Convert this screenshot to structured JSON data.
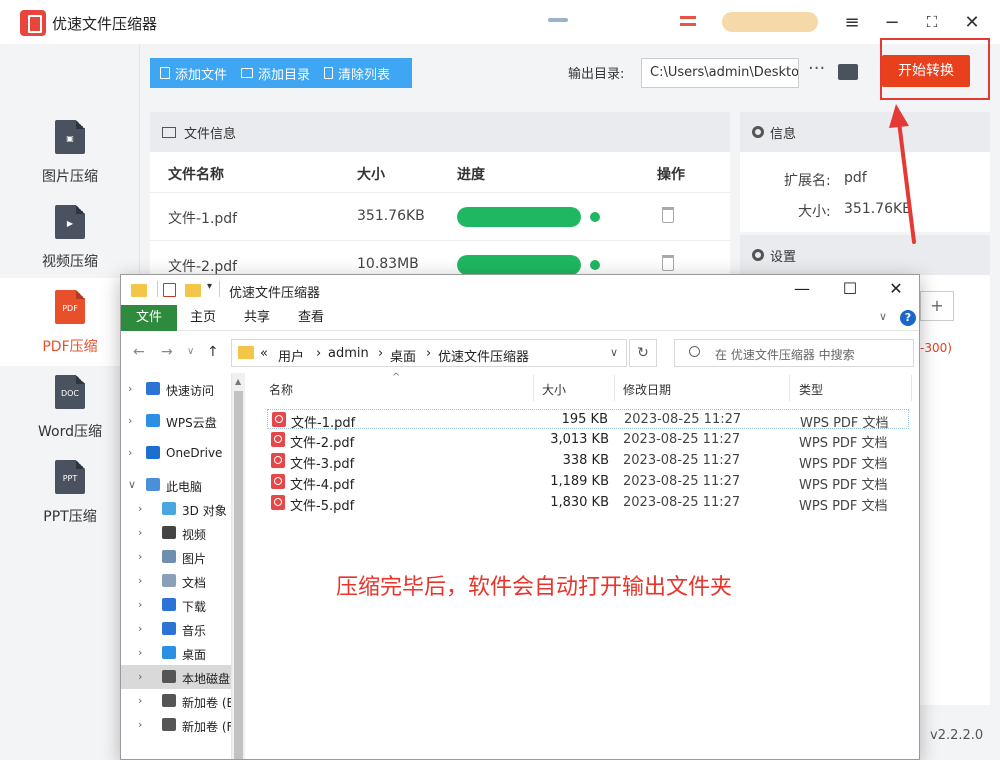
{
  "app": {
    "title": "优速文件压缩器",
    "sidebar": [
      {
        "label": "图片压缩",
        "doc": "",
        "active": false
      },
      {
        "label": "视频压缩",
        "doc": "",
        "active": false
      },
      {
        "label": "PDF压缩",
        "doc": "PDF",
        "active": true
      },
      {
        "label": "Word压缩",
        "doc": "DOC",
        "active": false
      },
      {
        "label": "PPT压缩",
        "doc": "PPT",
        "active": false
      }
    ],
    "toolbar": {
      "add_file": "添加文件",
      "add_dir": "添加目录",
      "clear_list": "清除列表",
      "output_label": "输出目录:",
      "output_value": "C:\\Users\\admin\\Deskto",
      "more": "···",
      "start": "开始转换"
    },
    "file_panel": {
      "title": "文件信息",
      "columns": [
        "文件名称",
        "大小",
        "进度",
        "操作"
      ],
      "rows": [
        {
          "name": "文件-1.pdf",
          "size": "351.76KB",
          "progress": 100
        },
        {
          "name": "文件-2.pdf",
          "size": "10.83MB",
          "progress": 100
        }
      ]
    },
    "info_panel": {
      "title": "信息",
      "ext_label": "扩展名:",
      "ext_value": "pdf",
      "size_label": "大小:",
      "size_value": "351.76KB"
    },
    "settings_panel": {
      "title": "设置",
      "plus": "+",
      "range": "-300)"
    },
    "version": "v2.2.2.0"
  },
  "explorer": {
    "title": "优速文件压缩器",
    "ribbon_tabs": [
      "文件",
      "主页",
      "共享",
      "查看"
    ],
    "help": "?",
    "breadcrumb": [
      "«",
      "用户",
      "›",
      "admin",
      "›",
      "桌面",
      "›",
      "优速文件压缩器"
    ],
    "refresh": "↻",
    "search_placeholder": "在 优速文件压缩器 中搜索",
    "nav": [
      {
        "label": "快速访问",
        "icon": "star-icon",
        "color": "#2b74d6",
        "indent": 0
      },
      {
        "label": "WPS云盘",
        "icon": "cloud-icon",
        "color": "#2b8fe3",
        "indent": 0
      },
      {
        "label": "OneDrive",
        "icon": "onedrive-icon",
        "color": "#1a6fcf",
        "indent": 0
      },
      {
        "label": "此电脑",
        "icon": "computer-icon",
        "color": "#4a90d9",
        "indent": 0,
        "expanded": true
      },
      {
        "label": "3D 对象",
        "icon": "cube-icon",
        "color": "#4aa6e0",
        "indent": 1
      },
      {
        "label": "视频",
        "icon": "video-icon",
        "color": "#444444",
        "indent": 1
      },
      {
        "label": "图片",
        "icon": "picture-icon",
        "color": "#6f8fb0",
        "indent": 1
      },
      {
        "label": "文档",
        "icon": "document-icon",
        "color": "#8aa0b8",
        "indent": 1
      },
      {
        "label": "下载",
        "icon": "download-icon",
        "color": "#2b74d6",
        "indent": 1
      },
      {
        "label": "音乐",
        "icon": "music-icon",
        "color": "#2b74d6",
        "indent": 1
      },
      {
        "label": "桌面",
        "icon": "desktop-icon",
        "color": "#2b8fe3",
        "indent": 1
      },
      {
        "label": "本地磁盘 (",
        "icon": "drive-icon",
        "color": "#555555",
        "indent": 1,
        "selected": true
      },
      {
        "label": "新加卷 (E:)",
        "icon": "drive-icon",
        "color": "#555555",
        "indent": 1
      },
      {
        "label": "新加卷 (F:)",
        "icon": "drive-icon",
        "color": "#555555",
        "indent": 1
      }
    ],
    "columns": [
      "名称",
      "大小",
      "修改日期",
      "类型"
    ],
    "files": [
      {
        "name": "文件-1.pdf",
        "size": "195 KB",
        "date": "2023-08-25 11:27",
        "type": "WPS PDF 文档"
      },
      {
        "name": "文件-2.pdf",
        "size": "3,013 KB",
        "date": "2023-08-25 11:27",
        "type": "WPS PDF 文档"
      },
      {
        "name": "文件-3.pdf",
        "size": "338 KB",
        "date": "2023-08-25 11:27",
        "type": "WPS PDF 文档"
      },
      {
        "name": "文件-4.pdf",
        "size": "1,189 KB",
        "date": "2023-08-25 11:27",
        "type": "WPS PDF 文档"
      },
      {
        "name": "文件-5.pdf",
        "size": "1,830 KB",
        "date": "2023-08-25 11:27",
        "type": "WPS PDF 文档"
      }
    ],
    "annotation": "压缩完毕后，软件会自动打开输出文件夹"
  },
  "colors": {
    "accent_blue": "#3ea6f2",
    "start_red": "#e8401c",
    "progress_green": "#1fb761",
    "annotation_red": "#e8342a"
  }
}
